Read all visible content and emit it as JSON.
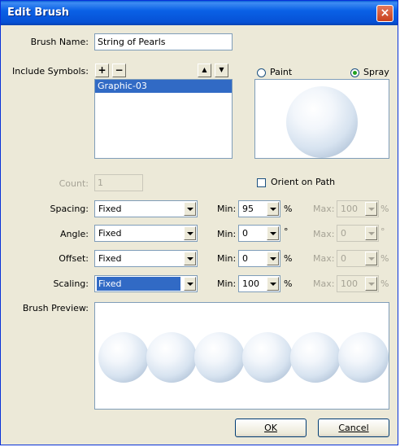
{
  "window": {
    "title": "Edit Brush",
    "close_icon": "×"
  },
  "brush_name": {
    "label": "Brush Name:",
    "value": "String of Pearls"
  },
  "include_symbols": {
    "label": "Include Symbols:",
    "add": "+",
    "remove": "−",
    "up": "▲",
    "down": "▼",
    "items": [
      "Graphic-03"
    ]
  },
  "mode": {
    "paint": "Paint",
    "spray": "Spray",
    "selected": "spray"
  },
  "count": {
    "label": "Count:",
    "value": "1"
  },
  "orient": {
    "label": "Orient on Path",
    "checked": false
  },
  "rows": [
    {
      "label": "Spacing:",
      "mode": "Fixed",
      "min_label": "Min:",
      "min": "95",
      "min_unit": "%",
      "max_label": "Max:",
      "max": "100",
      "max_unit": "%"
    },
    {
      "label": "Angle:",
      "mode": "Fixed",
      "min_label": "Min:",
      "min": "0",
      "min_unit": "°",
      "max_label": "Max:",
      "max": "0",
      "max_unit": "°"
    },
    {
      "label": "Offset:",
      "mode": "Fixed",
      "min_label": "Min:",
      "min": "0",
      "min_unit": "%",
      "max_label": "Max:",
      "max": "0",
      "max_unit": "%"
    },
    {
      "label": "Scaling:",
      "mode": "Fixed",
      "min_label": "Min:",
      "min": "100",
      "min_unit": "%",
      "max_label": "Max:",
      "max": "100",
      "max_unit": "%"
    }
  ],
  "brush_preview": {
    "label": "Brush Preview:"
  },
  "buttons": {
    "ok": "OK",
    "cancel": "Cancel"
  }
}
